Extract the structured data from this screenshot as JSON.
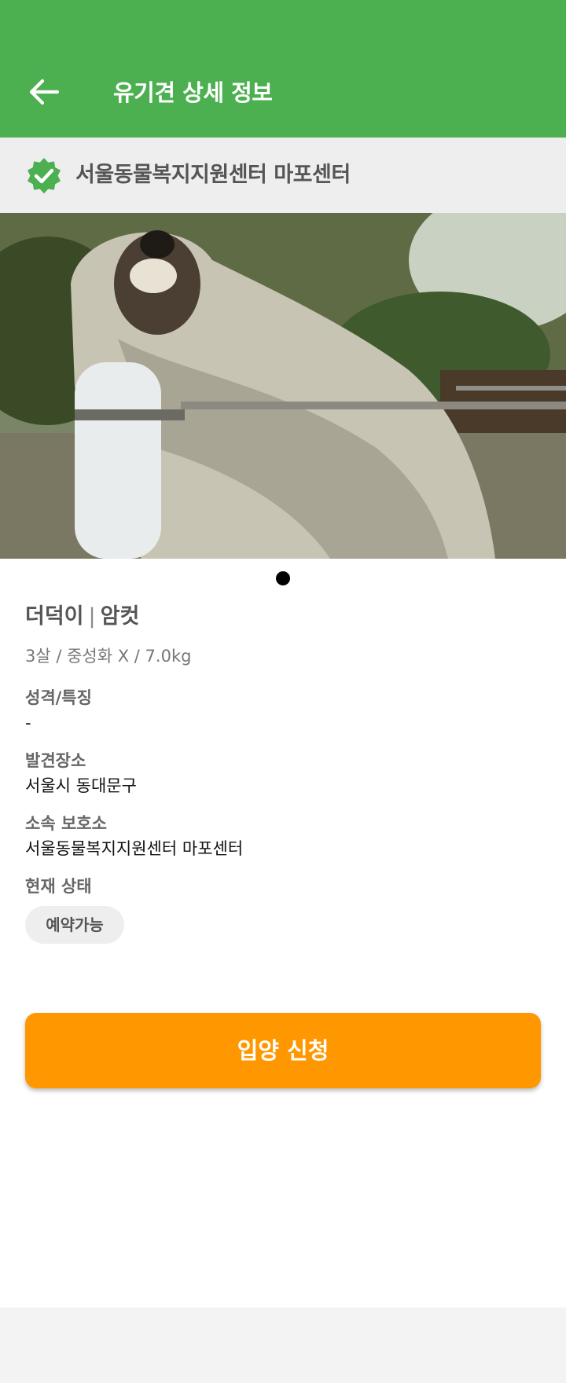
{
  "app_bar": {
    "title": "유기견 상세 정보",
    "back_icon": "arrow-left-icon",
    "background": "#4caf50"
  },
  "shelter_banner": {
    "icon": "verified-badge-icon",
    "name": "서울동물복지지원센터 마포센터"
  },
  "photo": {
    "pages": 1,
    "current_page": 1
  },
  "pet": {
    "name": "더덕이",
    "divider": "|",
    "sex": "암컷",
    "summary": "3살 / 중성화 X / 7.0kg"
  },
  "fields": {
    "personality_label": "성격/특징",
    "personality_value": "-",
    "found_place_label": "발견장소",
    "found_place_value": "서울시 동대문구",
    "shelter_label": "소속 보호소",
    "shelter_value": "서울동물복지지원센터 마포센터",
    "status_label": "현재 상태",
    "status_value": "예약가능"
  },
  "actions": {
    "adopt_label": "입양 신청"
  },
  "colors": {
    "primary": "#4caf50",
    "accent": "#ff9800",
    "banner_bg": "#eeeeee"
  }
}
